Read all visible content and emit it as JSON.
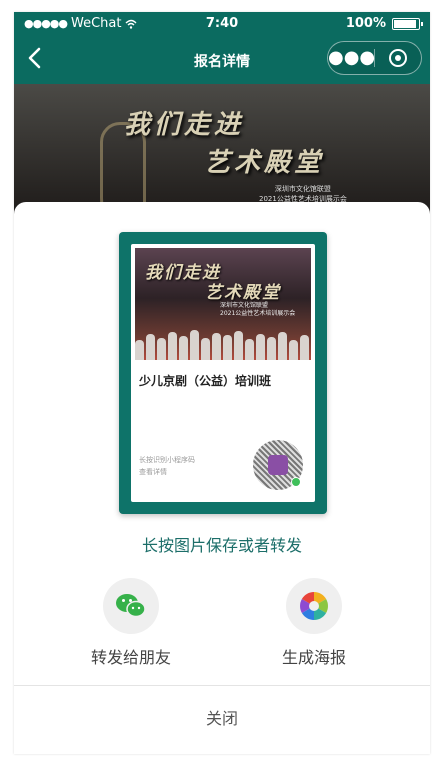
{
  "status_bar": {
    "carrier": "WeChat",
    "time": "7:40",
    "battery": "100%"
  },
  "navbar": {
    "title": "报名详情"
  },
  "banner": {
    "line1": "我们走进",
    "line2": "艺术殿堂",
    "subtitle_line1": "深圳市文化馆联盟",
    "subtitle_line2": "2021公益性艺术培训展示会"
  },
  "poster": {
    "title": "少儿京剧（公益）培训班",
    "hint_line1": "长按识别小程序码",
    "hint_line2": "查看详情"
  },
  "save_hint": "长按图片保存或者转发",
  "actions": [
    {
      "label": "转发给朋友",
      "icon": "wechat-icon"
    },
    {
      "label": "生成海报",
      "icon": "photos-icon"
    }
  ],
  "close_label": "关闭",
  "colors": {
    "theme": "#0b6b60",
    "accent_text": "#1c6e69"
  }
}
